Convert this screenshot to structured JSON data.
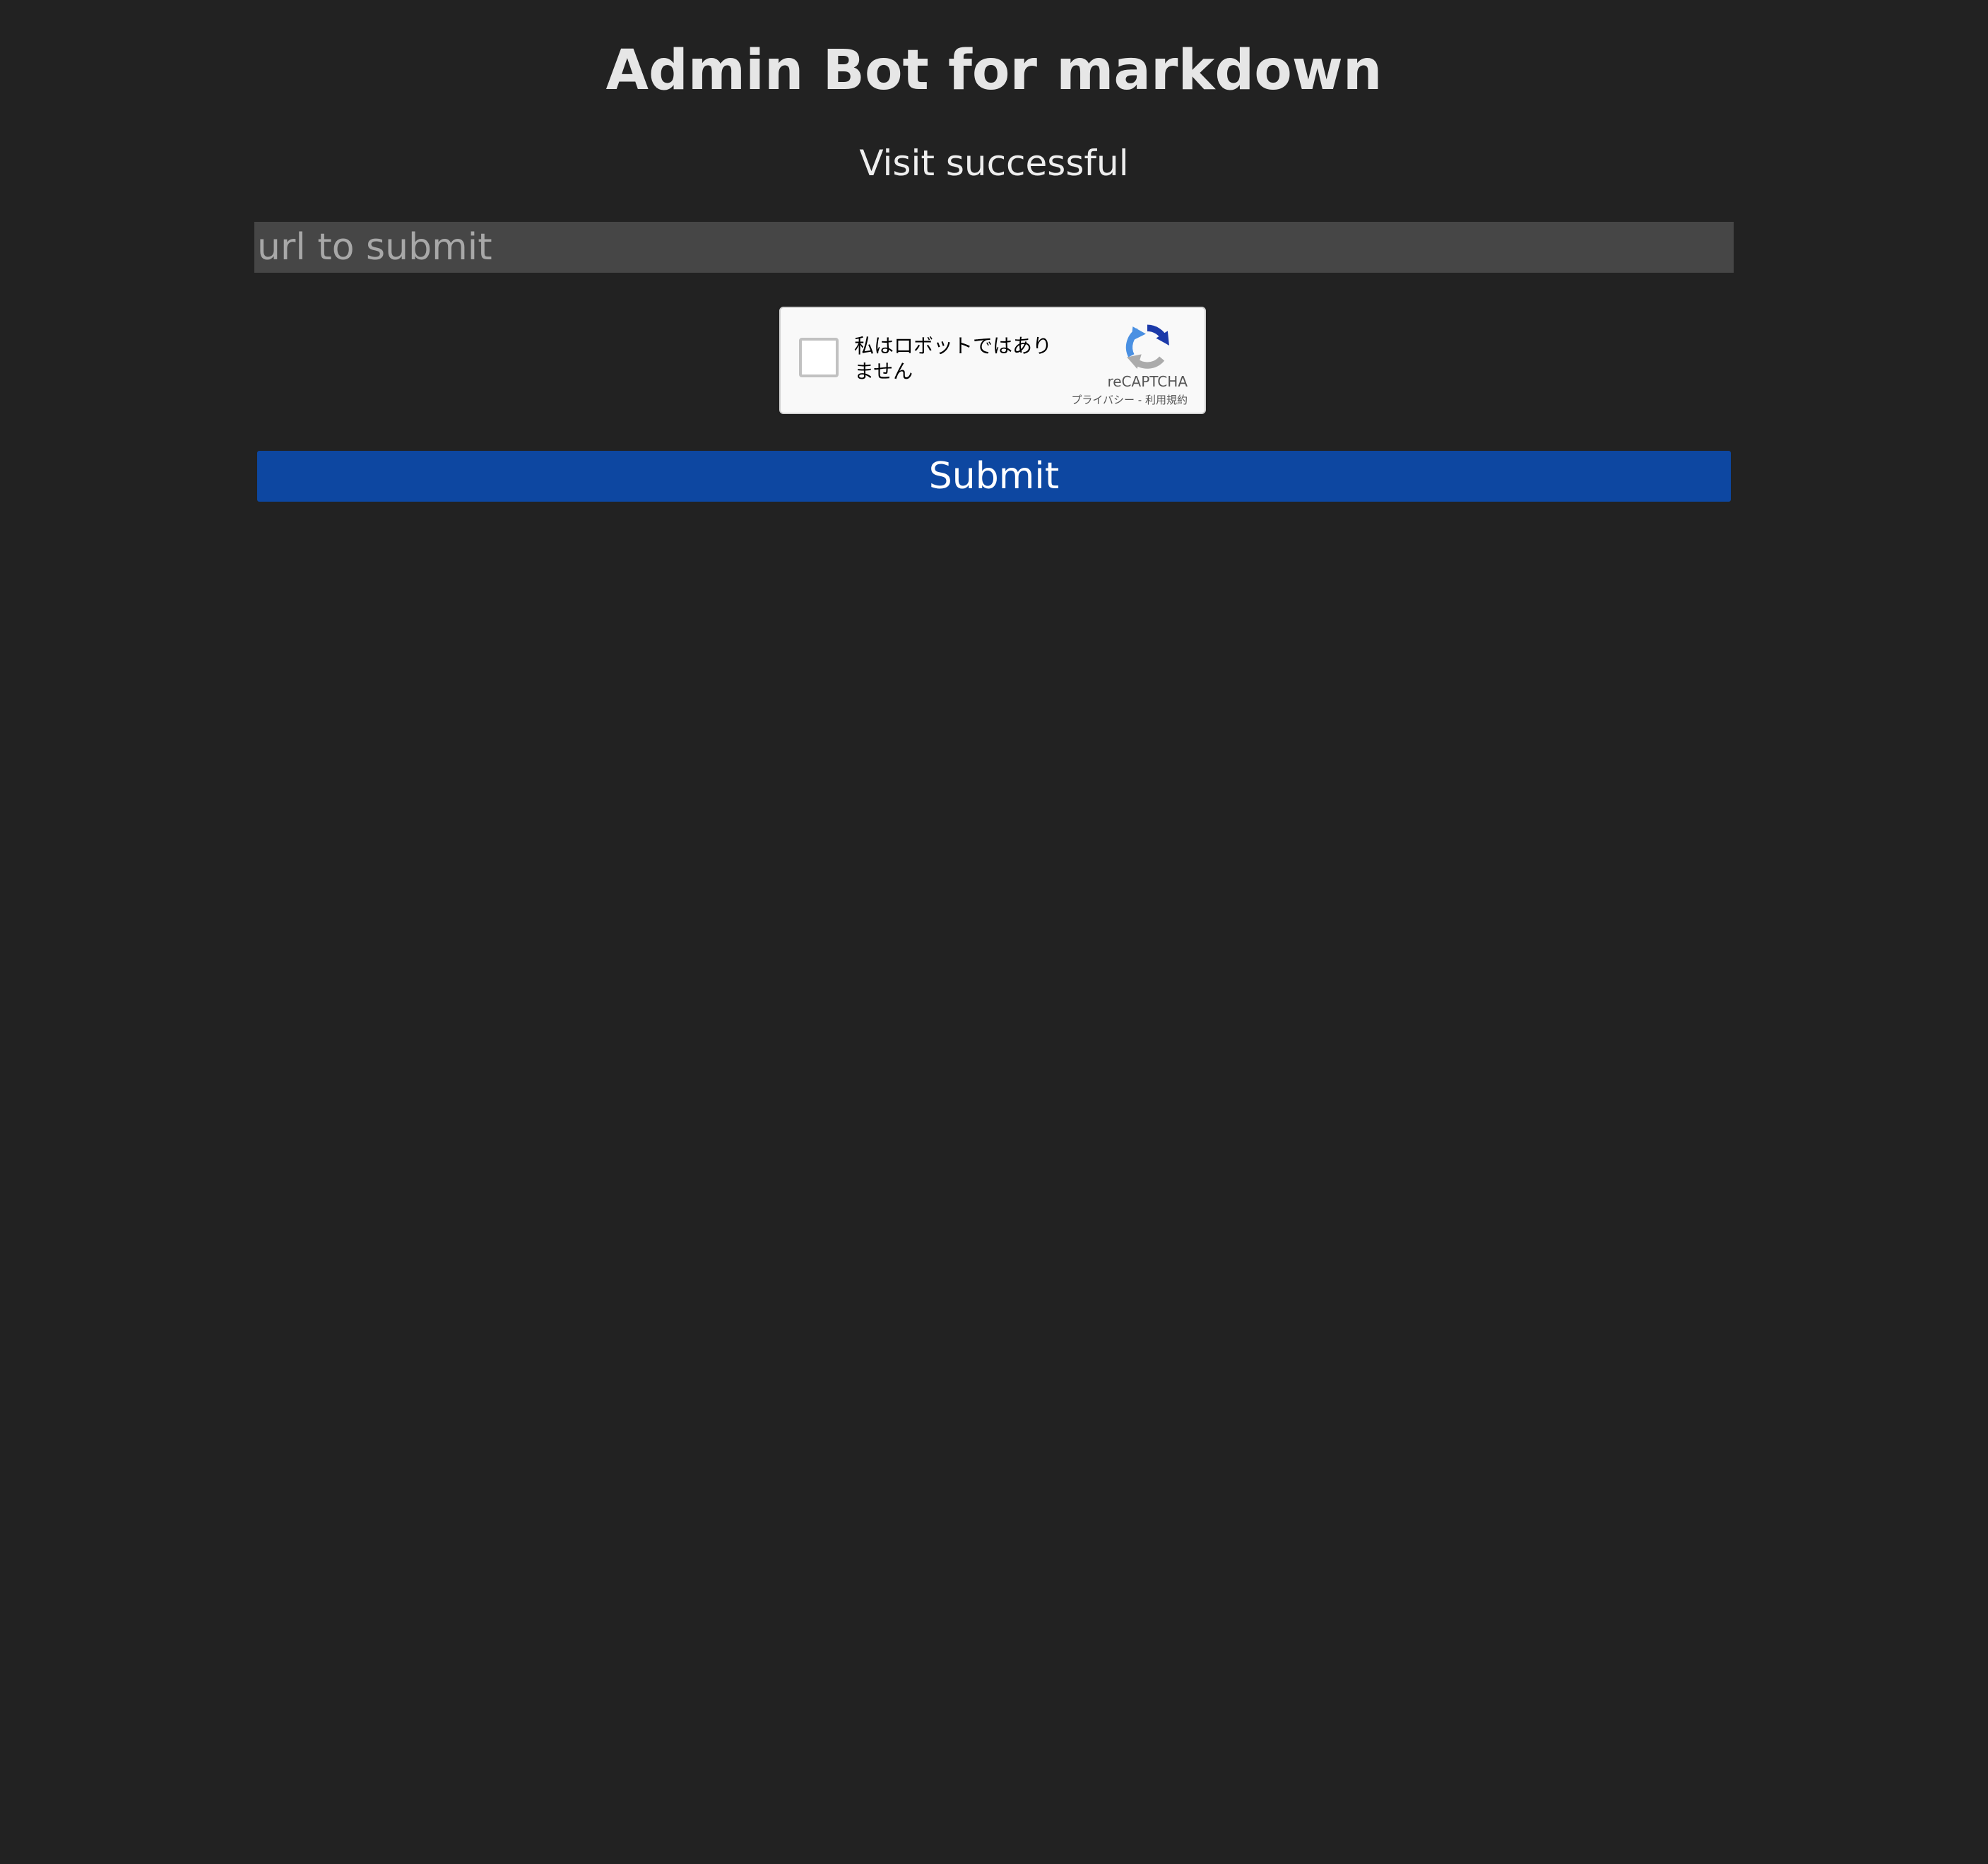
{
  "page": {
    "title": "Admin Bot for markdown",
    "status_message": "Visit successful"
  },
  "form": {
    "url_placeholder": "url to submit",
    "url_value": "",
    "submit_label": "Submit"
  },
  "recaptcha": {
    "checkbox_label": "私はロボットではありません",
    "brand": "reCAPTCHA",
    "privacy_link": "プライバシー",
    "separator": " - ",
    "terms_link": "利用規約",
    "checked": false
  },
  "colors": {
    "background": "#222222",
    "text": "#e6e6e6",
    "input_background": "#464646",
    "submit_background": "#0d47a1",
    "recaptcha_blue": "#1c3aa9",
    "recaptcha_light_blue": "#4a90e2",
    "recaptcha_gray": "#ababab"
  },
  "icons": {
    "recaptcha_logo": "recaptcha-logo-icon"
  }
}
